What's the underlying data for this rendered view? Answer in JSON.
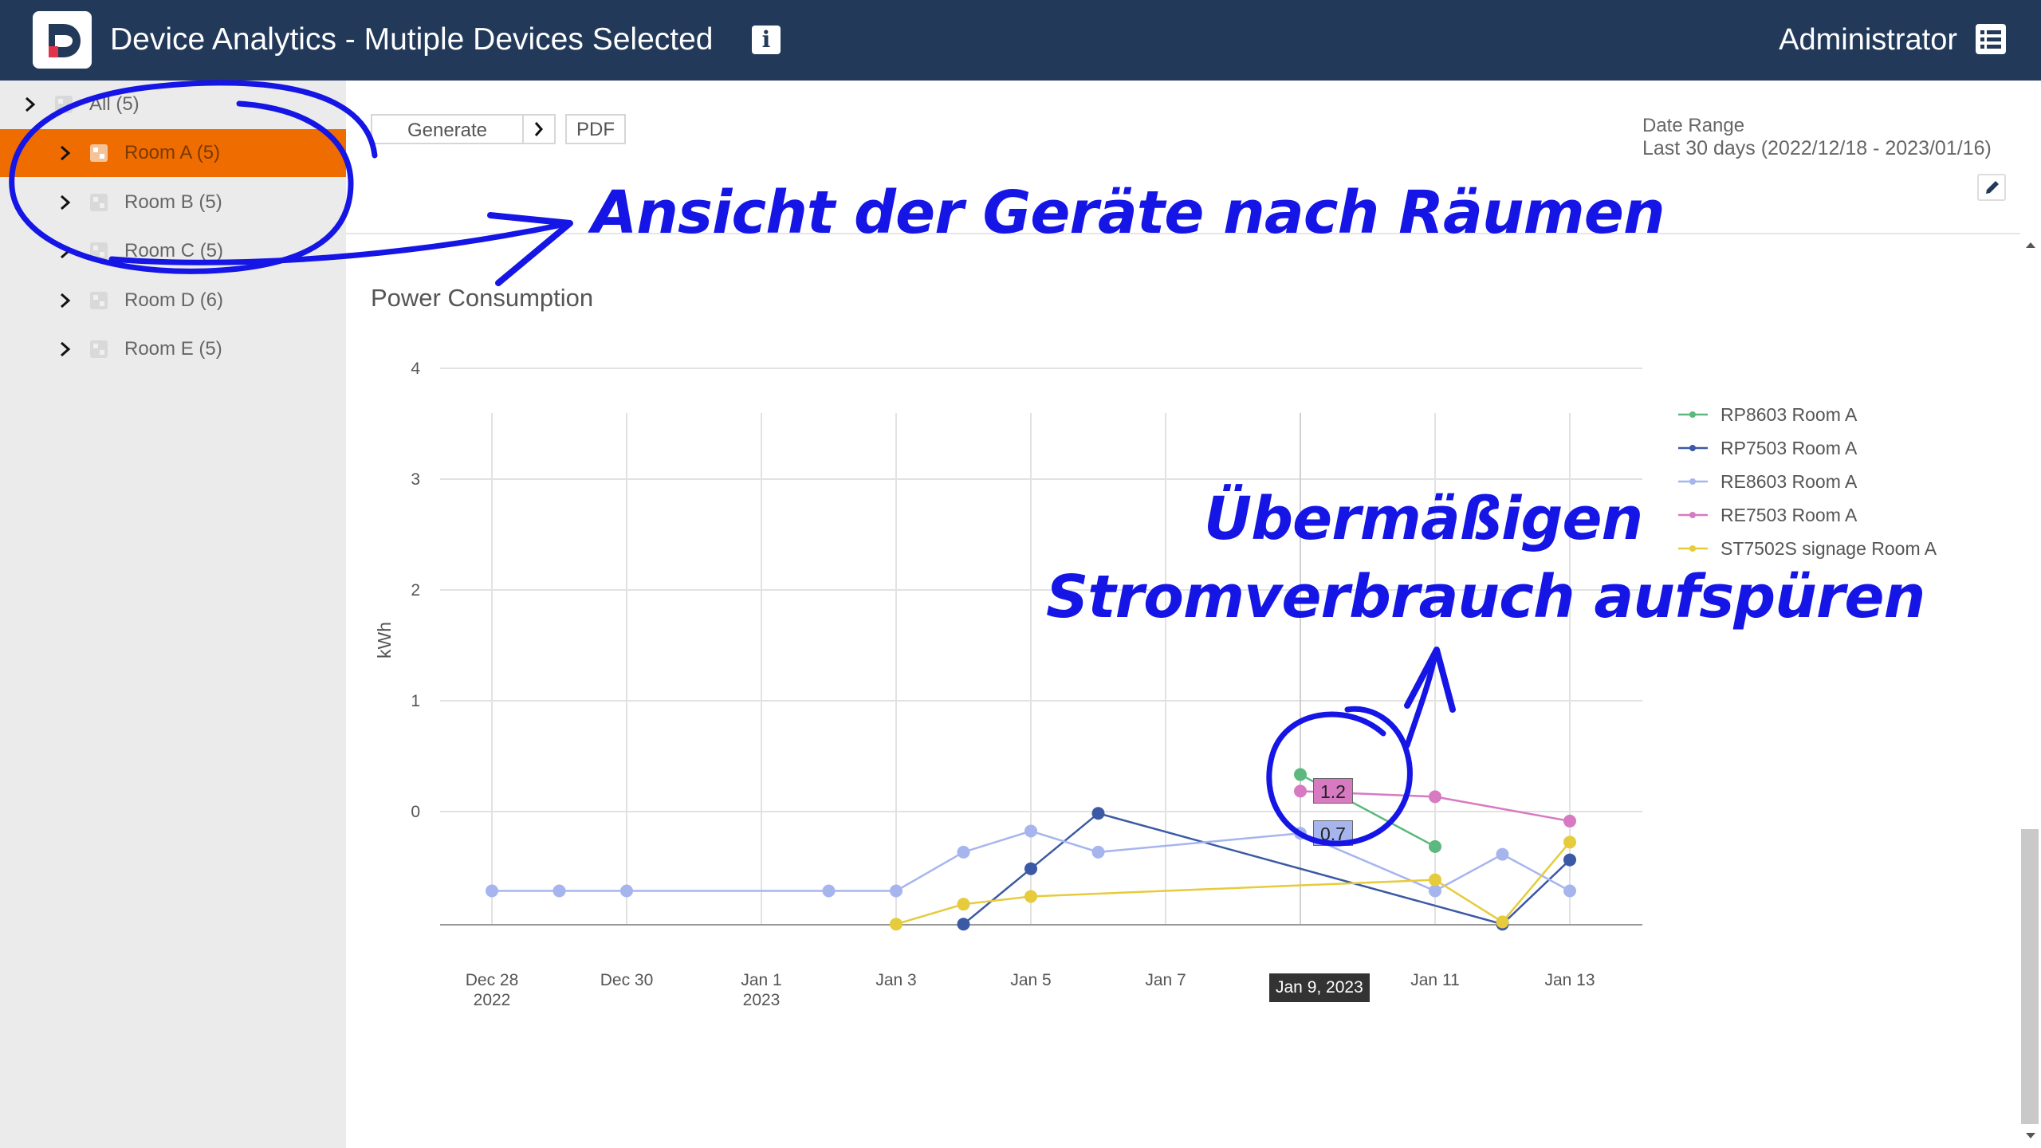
{
  "header": {
    "title": "Device Analytics - Mutiple Devices Selected",
    "user": "Administrator",
    "bg_color": "#22395a"
  },
  "sidebar": {
    "items": [
      {
        "label": "All (5)",
        "level": 0,
        "selected": false
      },
      {
        "label": "Room A (5)",
        "level": 1,
        "selected": true
      },
      {
        "label": "Room B (5)",
        "level": 1,
        "selected": false
      },
      {
        "label": "Room C (5)",
        "level": 1,
        "selected": false
      },
      {
        "label": "Room D (6)",
        "level": 1,
        "selected": false
      },
      {
        "label": "Room E (5)",
        "level": 1,
        "selected": false
      }
    ],
    "selected_color": "#ef6c00"
  },
  "toolbar": {
    "generate_label": "Generate",
    "pdf_label": "PDF"
  },
  "date_range": {
    "label": "Date Range",
    "value": "Last 30 days (2022/12/18 - 2023/01/16)"
  },
  "annotations": {
    "rooms_note": "Ansicht der Geräte nach Räumen",
    "consumption_line1": "Übermäßigen",
    "consumption_line2": "Stromverbrauch aufspüren",
    "color": "#1515e6"
  },
  "chart_data": {
    "type": "line",
    "title": "Power Consumption",
    "ylabel": "kWh",
    "x_ticks": [
      "Dec 28\n2022",
      "Dec 30",
      "Jan 1\n2023",
      "Jan 3",
      "Jan 5",
      "Jan 7",
      "Jan 9",
      "Jan 11",
      "Jan 13"
    ],
    "y_ticks": [
      "0",
      "1",
      "2",
      "3",
      "4"
    ],
    "ylim": [
      -1,
      4.6
    ],
    "legend_position": "right",
    "hover": {
      "x_label": "Jan 9, 2023",
      "values": [
        {
          "series": "RE7503 Room A",
          "text": "1.2"
        },
        {
          "series": "RE8603 Room A",
          "text": "0.7"
        }
      ]
    },
    "series": [
      {
        "name": "RP8603 Room A",
        "color": "#5cb87e",
        "points": [
          [
            "2023-01-09",
            0.55
          ],
          [
            "2023-01-11",
            -0.1
          ]
        ]
      },
      {
        "name": "RP7503 Room A",
        "color": "#3b59a4",
        "points": [
          [
            "2023-01-04",
            -0.8
          ],
          [
            "2023-01-05",
            -0.3
          ],
          [
            "2023-01-06",
            0.2
          ],
          [
            "2023-01-12",
            -0.8
          ],
          [
            "2023-01-13",
            -0.22
          ]
        ]
      },
      {
        "name": "RE8603 Room A",
        "color": "#a6b5ee",
        "points": [
          [
            "2022-12-28",
            -0.5
          ],
          [
            "2022-12-29",
            -0.5
          ],
          [
            "2022-12-30",
            -0.5
          ],
          [
            "2023-01-02",
            -0.5
          ],
          [
            "2023-01-03",
            -0.5
          ],
          [
            "2023-01-04",
            -0.15
          ],
          [
            "2023-01-05",
            0.04
          ],
          [
            "2023-01-06",
            -0.15
          ],
          [
            "2023-01-09",
            0.02
          ],
          [
            "2023-01-11",
            -0.5
          ],
          [
            "2023-01-12",
            -0.17
          ],
          [
            "2023-01-13",
            -0.5
          ]
        ]
      },
      {
        "name": "RE7503 Room A",
        "color": "#d77ac1",
        "points": [
          [
            "2023-01-09",
            0.4
          ],
          [
            "2023-01-11",
            0.35
          ],
          [
            "2023-01-13",
            0.13
          ]
        ]
      },
      {
        "name": "ST7502S signage Room A",
        "color": "#e6cb3c",
        "points": [
          [
            "2023-01-03",
            -0.8
          ],
          [
            "2023-01-04",
            -0.62
          ],
          [
            "2023-01-05",
            -0.55
          ],
          [
            "2023-01-11",
            -0.4
          ],
          [
            "2023-01-12",
            -0.78
          ],
          [
            "2023-01-13",
            -0.06
          ]
        ]
      }
    ]
  }
}
